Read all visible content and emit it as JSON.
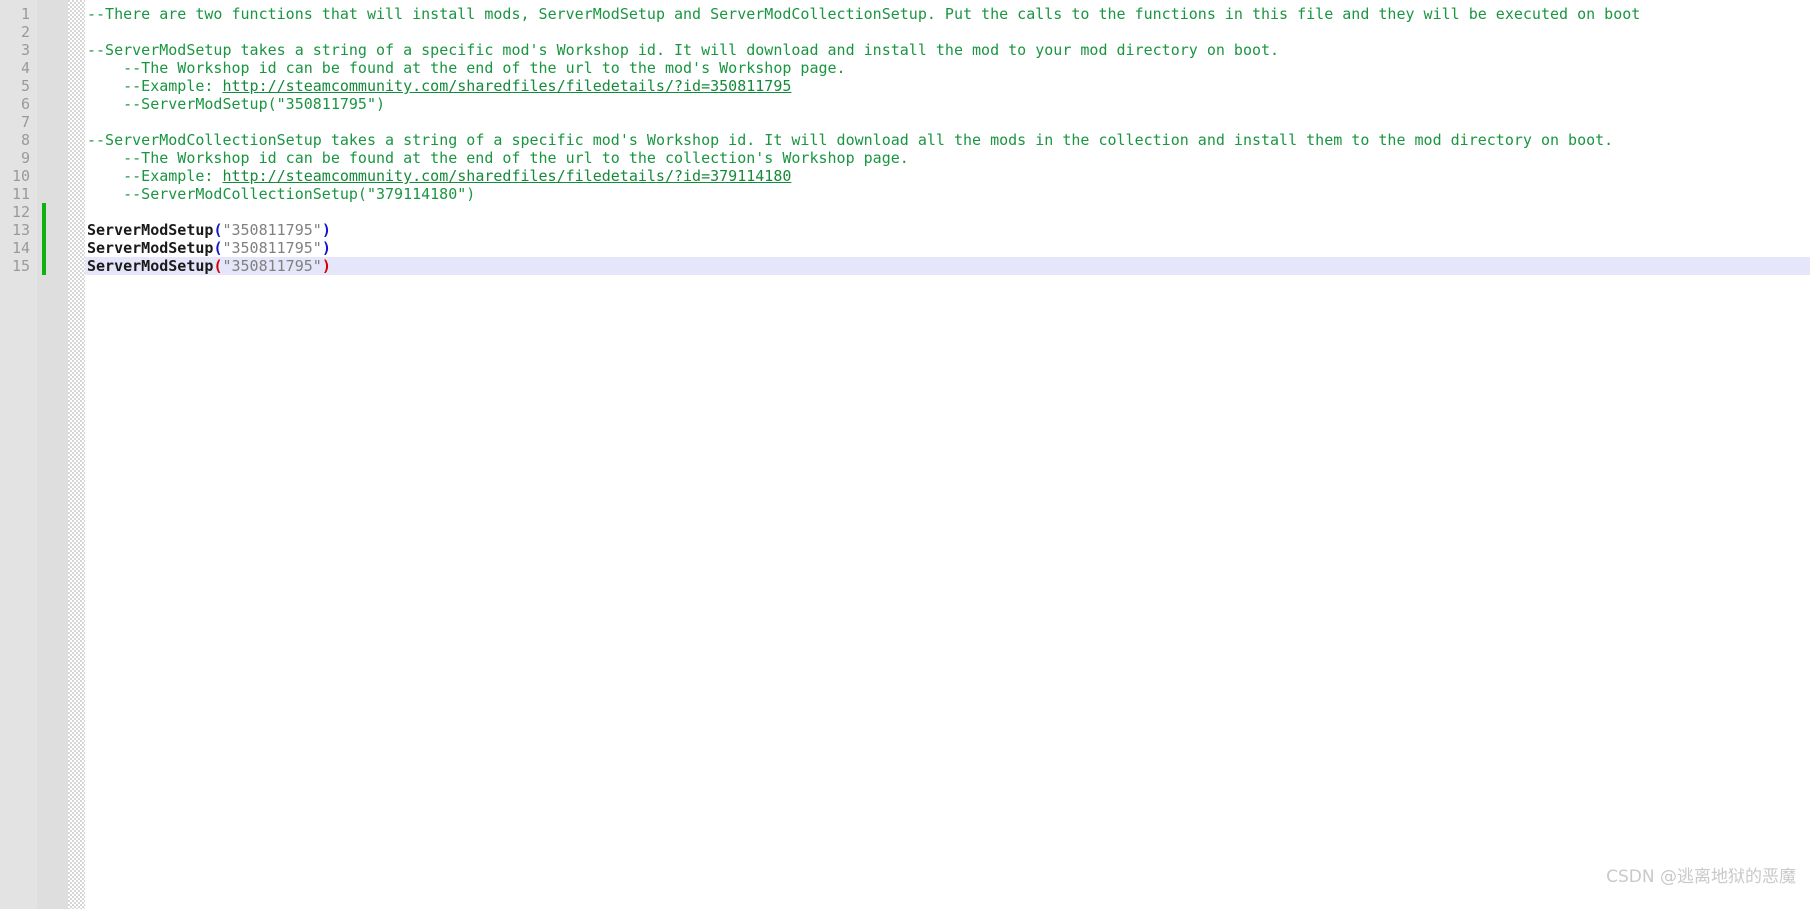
{
  "editor": {
    "name": "code-editor",
    "language": "Lua",
    "current_line": 15,
    "colors": {
      "background": "#ffffff",
      "gutter_numbers_bg": "#e3e3e3",
      "gutter_bookmark_bg": "#dedede",
      "comment": "#1a9641",
      "url_link": "#158a3a",
      "identifier": "#1a1a1a",
      "bracket": "#1414c8",
      "bracket_match": "#d40000",
      "string": "#808080",
      "current_line_highlight": "#e6e6fa",
      "change_marker": "#12b012",
      "line_number": "#9a9a9a",
      "watermark": "#c9c9c9"
    }
  },
  "gutter": {
    "line_numbers": [
      "1",
      "2",
      "3",
      "4",
      "5",
      "6",
      "7",
      "8",
      "9",
      "10",
      "11",
      "12",
      "13",
      "14",
      "15"
    ],
    "change_marker_start_line": 12,
    "change_marker_end_line": 15
  },
  "lines": [
    {
      "number": "1",
      "indent": 0,
      "tokens": [
        {
          "kind": "comment",
          "text": "--There are two functions that will install mods, ServerModSetup and ServerModCollectionSetup. Put the calls to the functions in this file and they will be executed on boot"
        }
      ]
    },
    {
      "number": "2",
      "indent": 0,
      "tokens": []
    },
    {
      "number": "3",
      "indent": 0,
      "tokens": [
        {
          "kind": "comment",
          "text": "--ServerModSetup takes a string of a specific mod's Workshop id. It will download and install the mod to your mod directory on boot."
        }
      ]
    },
    {
      "number": "4",
      "indent": 4,
      "tokens": [
        {
          "kind": "comment",
          "text": "--The Workshop id can be found at the end of the url to the mod's Workshop page."
        }
      ]
    },
    {
      "number": "5",
      "indent": 4,
      "tokens": [
        {
          "kind": "comment",
          "text": "--Example: "
        },
        {
          "kind": "url",
          "text": "http://steamcommunity.com/sharedfiles/filedetails/?id=350811795"
        }
      ]
    },
    {
      "number": "6",
      "indent": 4,
      "tokens": [
        {
          "kind": "comment",
          "text": "--ServerModSetup(\"350811795\")"
        }
      ]
    },
    {
      "number": "7",
      "indent": 0,
      "tokens": []
    },
    {
      "number": "8",
      "indent": 0,
      "tokens": [
        {
          "kind": "comment",
          "text": "--ServerModCollectionSetup takes a string of a specific mod's Workshop id. It will download all the mods in the collection and install them to the mod directory on boot."
        }
      ]
    },
    {
      "number": "9",
      "indent": 4,
      "tokens": [
        {
          "kind": "comment",
          "text": "--The Workshop id can be found at the end of the url to the collection's Workshop page."
        }
      ]
    },
    {
      "number": "10",
      "indent": 4,
      "tokens": [
        {
          "kind": "comment",
          "text": "--Example: "
        },
        {
          "kind": "url",
          "text": "http://steamcommunity.com/sharedfiles/filedetails/?id=379114180"
        }
      ]
    },
    {
      "number": "11",
      "indent": 4,
      "tokens": [
        {
          "kind": "comment",
          "text": "--ServerModCollectionSetup(\"379114180\")"
        }
      ]
    },
    {
      "number": "12",
      "indent": 0,
      "tokens": []
    },
    {
      "number": "13",
      "indent": 0,
      "tokens": [
        {
          "kind": "identifier",
          "text": "ServerModSetup"
        },
        {
          "kind": "bracket",
          "text": "("
        },
        {
          "kind": "string",
          "text": "\"350811795\""
        },
        {
          "kind": "bracket",
          "text": ")"
        }
      ]
    },
    {
      "number": "14",
      "indent": 0,
      "tokens": [
        {
          "kind": "identifier",
          "text": "ServerModSetup"
        },
        {
          "kind": "bracket",
          "text": "("
        },
        {
          "kind": "string",
          "text": "\"350811795\""
        },
        {
          "kind": "bracket",
          "text": ")"
        }
      ]
    },
    {
      "number": "15",
      "indent": 0,
      "highlighted": true,
      "tokens": [
        {
          "kind": "identifier",
          "text": "ServerModSetup"
        },
        {
          "kind": "bracket-match",
          "text": "("
        },
        {
          "kind": "string",
          "text": "\"350811795\""
        },
        {
          "kind": "bracket-match",
          "text": ")"
        }
      ]
    }
  ],
  "watermark": {
    "text": "CSDN @逃离地狱的恶魔"
  }
}
